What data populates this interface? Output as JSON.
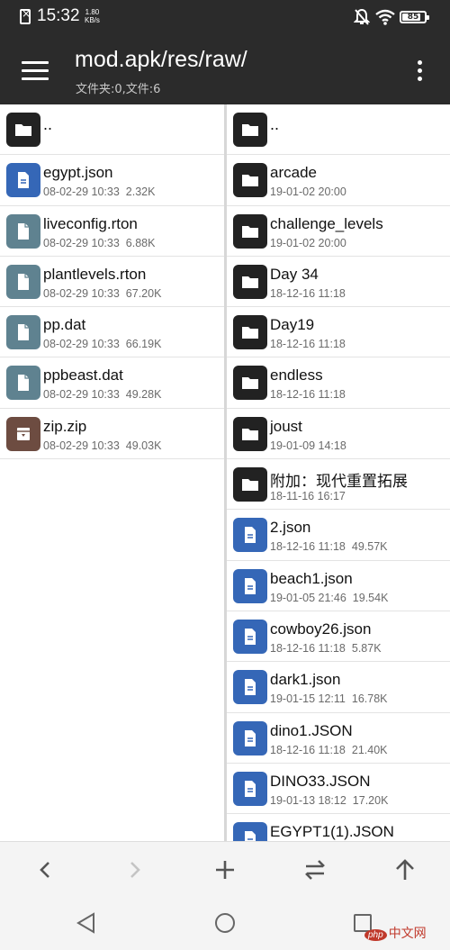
{
  "status": {
    "time": "15:32",
    "speed_value": "1.80",
    "speed_unit": "KB/s",
    "battery": "85",
    "battery_level": 0.85
  },
  "header": {
    "title": "mod.apk/res/raw/",
    "subtitle": "文件夹:0,文件:6",
    "menu_icon": "hamburger-menu-icon",
    "more_icon": "more-vert-icon"
  },
  "left_pane": {
    "parent": "..",
    "items": [
      {
        "name": "egypt.json",
        "date": "08-02-29 10:33",
        "size": "2.32K",
        "type": "json"
      },
      {
        "name": "liveconfig.rton",
        "date": "08-02-29 10:33",
        "size": "6.88K",
        "type": "file"
      },
      {
        "name": "plantlevels.rton",
        "date": "08-02-29 10:33",
        "size": "67.20K",
        "type": "file"
      },
      {
        "name": "pp.dat",
        "date": "08-02-29 10:33",
        "size": "66.19K",
        "type": "file"
      },
      {
        "name": "ppbeast.dat",
        "date": "08-02-29 10:33",
        "size": "49.28K",
        "type": "file"
      },
      {
        "name": "zip.zip",
        "date": "08-02-29 10:33",
        "size": "49.03K",
        "type": "zip"
      }
    ]
  },
  "right_pane": {
    "parent": "..",
    "items": [
      {
        "name": "arcade",
        "date": "19-01-02 20:00",
        "size": "",
        "type": "folder"
      },
      {
        "name": "challenge_levels",
        "date": "19-01-02 20:00",
        "size": "",
        "type": "folder"
      },
      {
        "name": "Day 34",
        "date": "18-12-16 11:18",
        "size": "",
        "type": "folder"
      },
      {
        "name": "Day19",
        "date": "18-12-16 11:18",
        "size": "",
        "type": "folder"
      },
      {
        "name": "endless",
        "date": "18-12-16 11:18",
        "size": "",
        "type": "folder"
      },
      {
        "name": "joust",
        "date": "19-01-09 14:18",
        "size": "",
        "type": "folder"
      },
      {
        "name": "附加：现代重置拓展",
        "date": "18-11-16 16:17",
        "size": "",
        "type": "folder"
      },
      {
        "name": "2.json",
        "date": "18-12-16 11:18",
        "size": "49.57K",
        "type": "json"
      },
      {
        "name": "beach1.json",
        "date": "19-01-05 21:46",
        "size": "19.54K",
        "type": "json"
      },
      {
        "name": "cowboy26.json",
        "date": "18-12-16 11:18",
        "size": "5.87K",
        "type": "json"
      },
      {
        "name": "dark1.json",
        "date": "19-01-15 12:11",
        "size": "16.78K",
        "type": "json"
      },
      {
        "name": "dino1.JSON",
        "date": "18-12-16 11:18",
        "size": "21.40K",
        "type": "json"
      },
      {
        "name": "DINO33.JSON",
        "date": "19-01-13 18:12",
        "size": "17.20K",
        "type": "json"
      },
      {
        "name": "EGYPT1(1).JSON",
        "date": "",
        "size": "",
        "type": "json"
      }
    ]
  },
  "toolbar": {
    "buttons": [
      "back-arrow-icon",
      "forward-arrow-icon",
      "add-icon",
      "swap-icon",
      "up-arrow-icon"
    ]
  },
  "navbar": {
    "buttons": [
      "back-triangle-icon",
      "home-circle-icon",
      "recents-square-icon"
    ]
  },
  "watermark": {
    "badge": "php",
    "text": "中文网"
  }
}
